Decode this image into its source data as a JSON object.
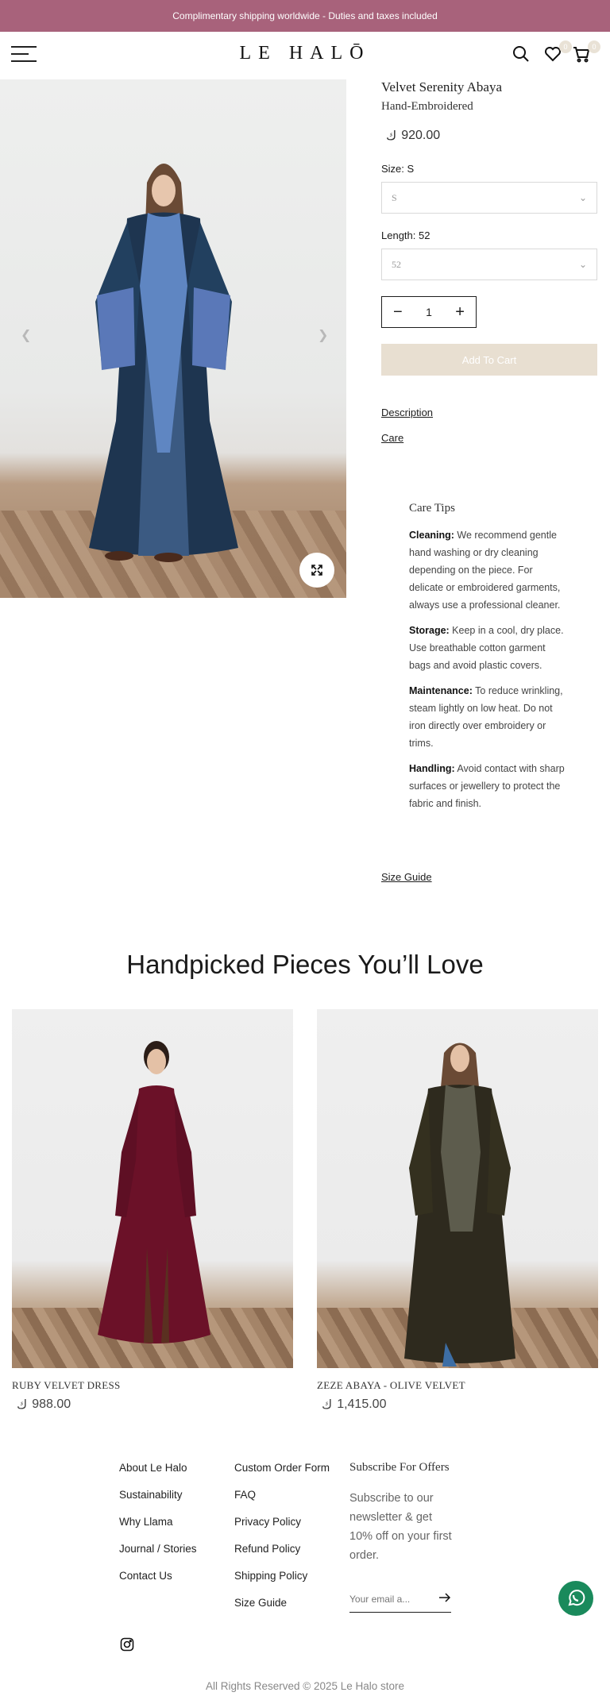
{
  "announcement": "Complimentary shipping worldwide - Duties and taxes included",
  "header": {
    "logo": "LE HALŌ",
    "wishlist_count": "0",
    "cart_count": "0"
  },
  "product": {
    "title": "Velvet Serenity Abaya",
    "subtitle": "Hand-Embroidered",
    "price": "920.00",
    "size_label": "Size: S",
    "size_value": "S",
    "length_label": "Length: 52",
    "length_value": "52",
    "quantity": "1",
    "add_to_cart": "Add To Cart",
    "description_link": "Description",
    "care_link": "Care",
    "size_guide_link": "Size Guide"
  },
  "care": {
    "title": "Care Tips",
    "items": [
      {
        "label": "Cleaning:",
        "text": " We recommend gentle hand washing or dry cleaning depending on the piece. For delicate or embroidered garments, always use a professional cleaner."
      },
      {
        "label": "Storage:",
        "text": " Keep in a cool, dry place. Use breathable cotton garment bags and avoid plastic covers."
      },
      {
        "label": "Maintenance:",
        "text": " To reduce wrinkling, steam lightly on low heat. Do not iron directly over embroidery or trims."
      },
      {
        "label": "Handling:",
        "text": " Avoid contact with sharp surfaces or jewellery to protect the fabric and finish."
      }
    ]
  },
  "recommendations": {
    "title": "Handpicked Pieces You’ll Love",
    "items": [
      {
        "name": "RUBY VELVET DRESS",
        "price": "988.00"
      },
      {
        "name": "ZEZE ABAYA - OLIVE VELVET",
        "price": "1,415.00"
      }
    ]
  },
  "footer": {
    "col1": [
      "About Le Halo",
      "Sustainability",
      "Why Llama",
      "Journal / Stories",
      "Contact Us"
    ],
    "col2": [
      "Custom Order Form",
      "FAQ",
      "Privacy Policy",
      "Refund Policy",
      "Shipping Policy",
      "Size Guide"
    ],
    "subscribe_title": "Subscribe For Offers",
    "subscribe_text": "Subscribe to our newsletter & get 10% off on your first order.",
    "email_placeholder": "Your email a...",
    "copyright": "All Rights Reserved © 2025 Le Halo store"
  },
  "colors": {
    "announcement_bg": "#a8627b",
    "add_to_cart_bg": "#e8dfd1",
    "whatsapp": "#1a8a5c"
  }
}
